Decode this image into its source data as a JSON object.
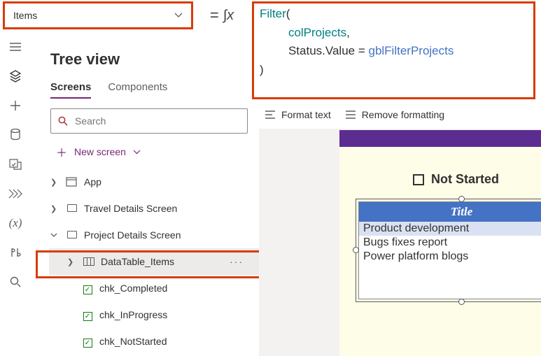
{
  "property_dropdown": {
    "value": "Items"
  },
  "formula": {
    "line1_a": "Filter",
    "line1_b": "(",
    "line2": "colProjects",
    "line2_suffix": ",",
    "line3_a": "Status",
    "line3_b": ".Value = ",
    "line3_c": "gblFilterProjects",
    "line4": ")"
  },
  "tree": {
    "title": "Tree view",
    "tabs": {
      "screens": "Screens",
      "components": "Components"
    },
    "search_placeholder": "Search",
    "new_screen": "New screen",
    "items": {
      "app": "App",
      "travel": "Travel Details Screen",
      "project": "Project Details Screen",
      "datatable": "DataTable_Items",
      "chk1": "chk_Completed",
      "chk2": "chk_InProgress",
      "chk3": "chk_NotStarted"
    }
  },
  "strip": {
    "format": "Format text",
    "remove": "Remove formatting"
  },
  "canvas": {
    "checkbox_label": "Not Started",
    "table": {
      "header": "Title",
      "rows": [
        "Product development",
        "Bugs fixes report",
        "Power platform blogs"
      ]
    }
  },
  "chart_data": {
    "type": "table",
    "title": "Title",
    "categories": [
      "Product development",
      "Bugs fixes report",
      "Power platform blogs"
    ]
  }
}
